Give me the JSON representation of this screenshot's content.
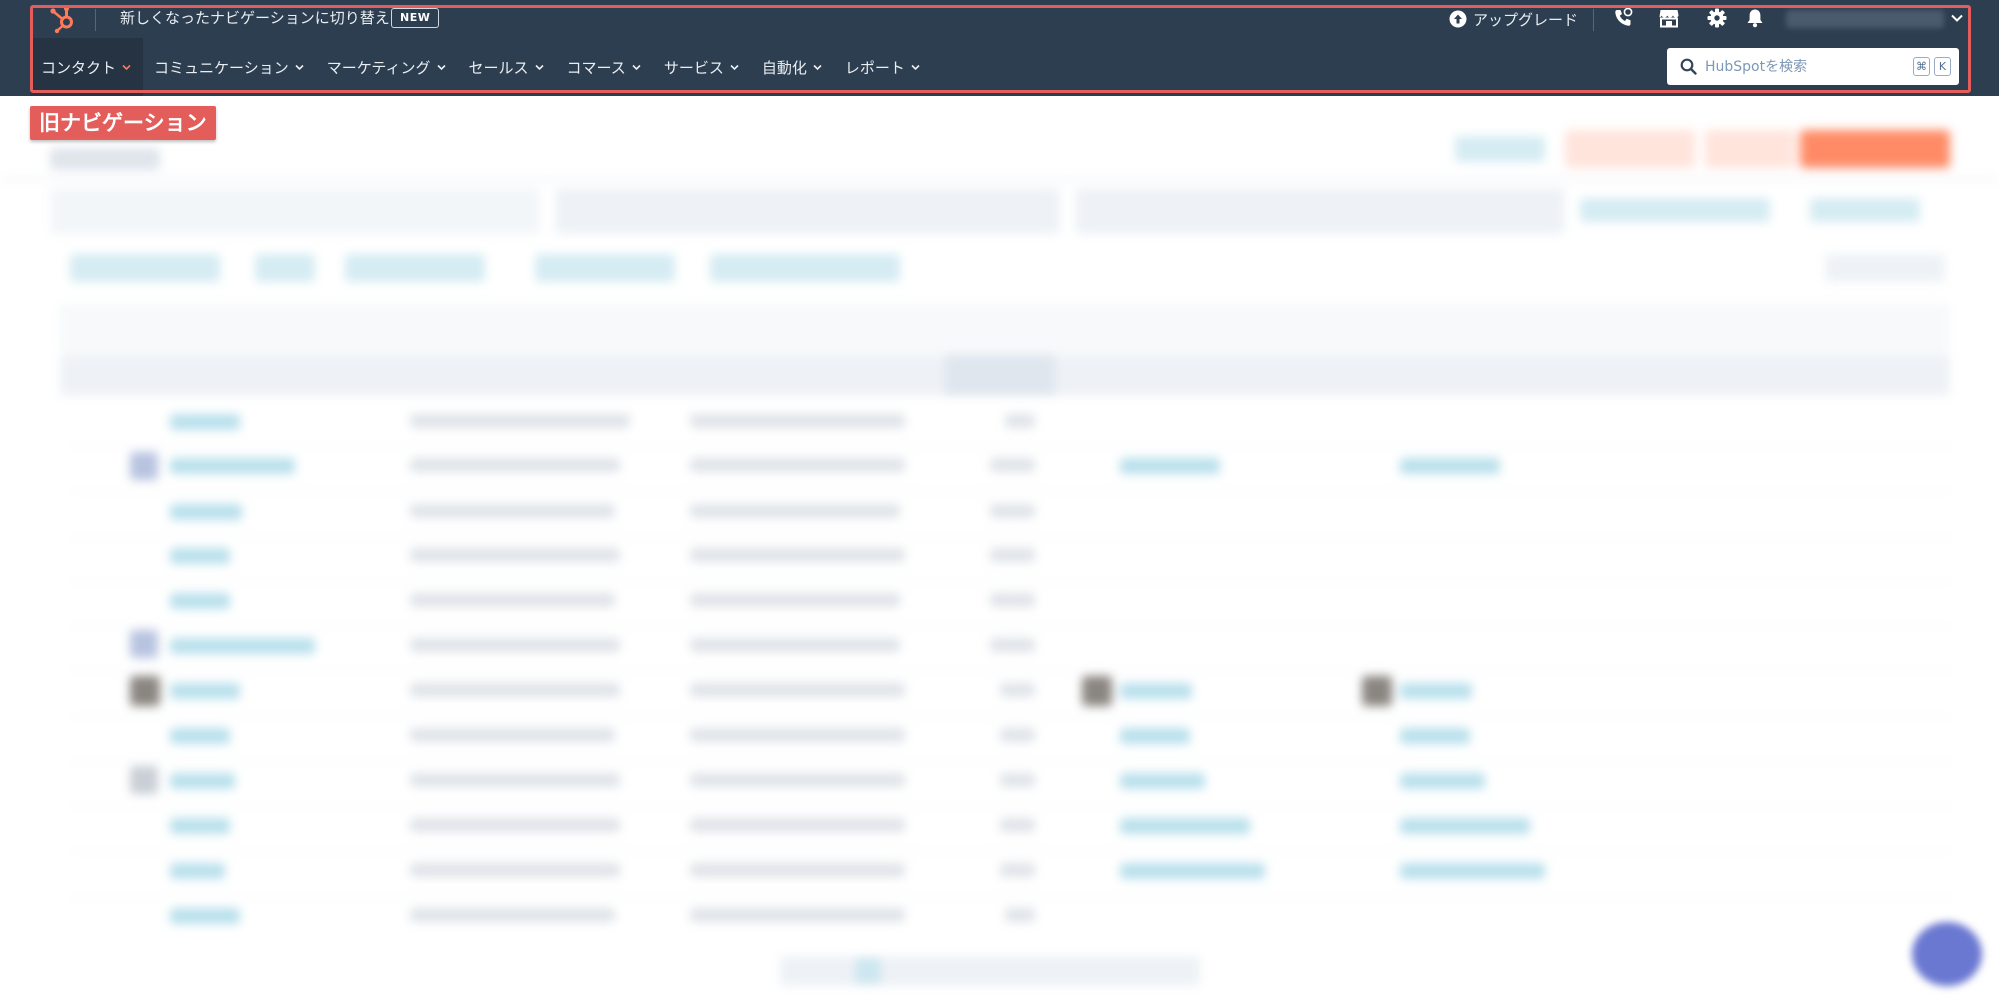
{
  "topnav": {
    "switch_text": "新しくなったナビゲーションに切り替え",
    "new_badge": "NEW",
    "upgrade_label": "アップグレード",
    "menu": [
      {
        "label": "コンタクト",
        "active": true
      },
      {
        "label": "コミュニケーション"
      },
      {
        "label": "マーケティング"
      },
      {
        "label": "セールス"
      },
      {
        "label": "コマース"
      },
      {
        "label": "サービス"
      },
      {
        "label": "自動化"
      },
      {
        "label": "レポート"
      }
    ],
    "search": {
      "placeholder": "HubSpotを検索",
      "shortcut_key1": "⌘",
      "shortcut_key2": "K"
    },
    "icons": [
      "hubspot-sprocket-icon",
      "calling-icon",
      "marketplace-icon",
      "settings-gear-icon",
      "notification-bell-icon",
      "chevron-down-icon",
      "search-icon"
    ]
  },
  "annotation": {
    "label": "旧ナビゲーション"
  },
  "colors": {
    "nav_bg": "#2d3e50",
    "nav_active_bg": "#253342",
    "hubspot_orange": "#ff7a59",
    "highlight_red": "#e35d5b",
    "link_blue": "#0091ae",
    "chat_fab": "#6a78d1"
  }
}
